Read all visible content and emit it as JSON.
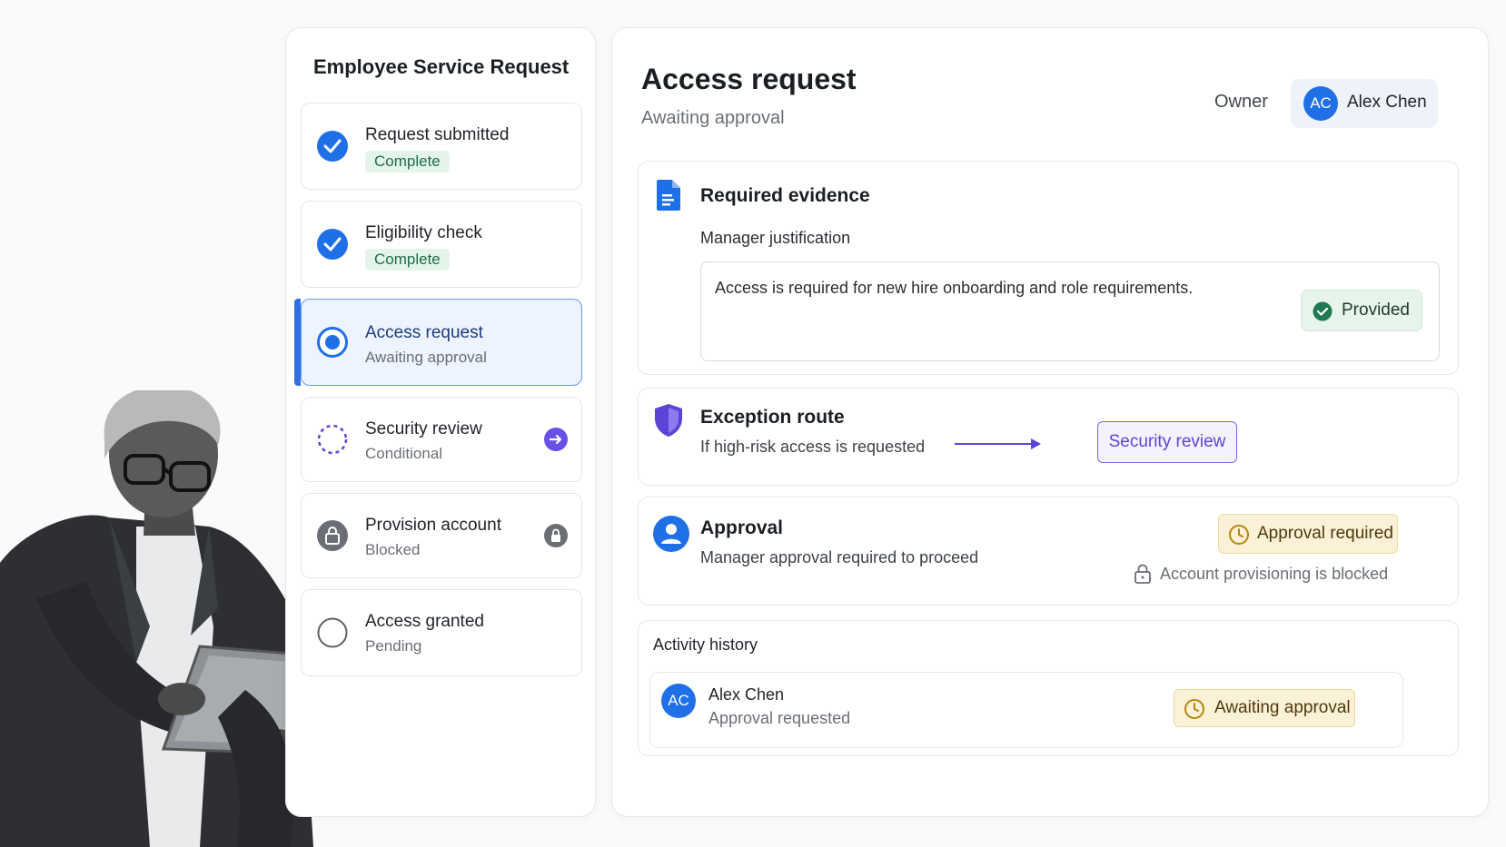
{
  "stepper": {
    "title": "Employee Service Request",
    "steps": [
      {
        "label": "Request submitted",
        "status": "Complete",
        "state": "done"
      },
      {
        "label": "Eligibility check",
        "status": "Complete",
        "state": "done"
      },
      {
        "label": "Access request",
        "status": "Awaiting approval",
        "state": "active"
      },
      {
        "label": "Security review",
        "status": "Conditional",
        "state": "conditional"
      },
      {
        "label": "Provision account",
        "status": "Blocked",
        "state": "blocked"
      },
      {
        "label": "Access granted",
        "status": "Pending",
        "state": "pending"
      }
    ]
  },
  "header": {
    "title": "Access request",
    "subtitle": "Awaiting approval",
    "owner_label": "Owner",
    "owner_initials": "AC",
    "owner_name": "Alex Chen"
  },
  "evidence": {
    "title": "Required evidence",
    "field_label": "Manager justification",
    "field_value": "Access is required for new hire onboarding and role requirements.",
    "status": "Provided"
  },
  "exception": {
    "title": "Exception route",
    "condition": "If high-risk access is requested",
    "target": "Security review"
  },
  "approval": {
    "title": "Approval",
    "description": "Manager approval required to proceed",
    "status": "Approval required",
    "blocked_note": "Account provisioning is blocked"
  },
  "activity": {
    "title": "Activity history",
    "items": [
      {
        "initials": "AC",
        "name": "Alex Chen",
        "action": "Approval requested",
        "status": "Awaiting approval"
      }
    ]
  },
  "icons": {
    "done": "check-circle-icon",
    "active": "radio-active-icon",
    "conditional": "dashed-circle-icon",
    "blocked": "lock-icon",
    "pending": "empty-circle-icon",
    "evidence": "document-icon",
    "exception": "shield-icon",
    "approval": "user-icon",
    "clock": "clock-icon"
  },
  "colors": {
    "primary": "#1f6fe6",
    "success_bg": "#e4f4ea",
    "success_text": "#1f6d46",
    "purple": "#5a45d6",
    "amber_bg": "#fbf1d7"
  }
}
